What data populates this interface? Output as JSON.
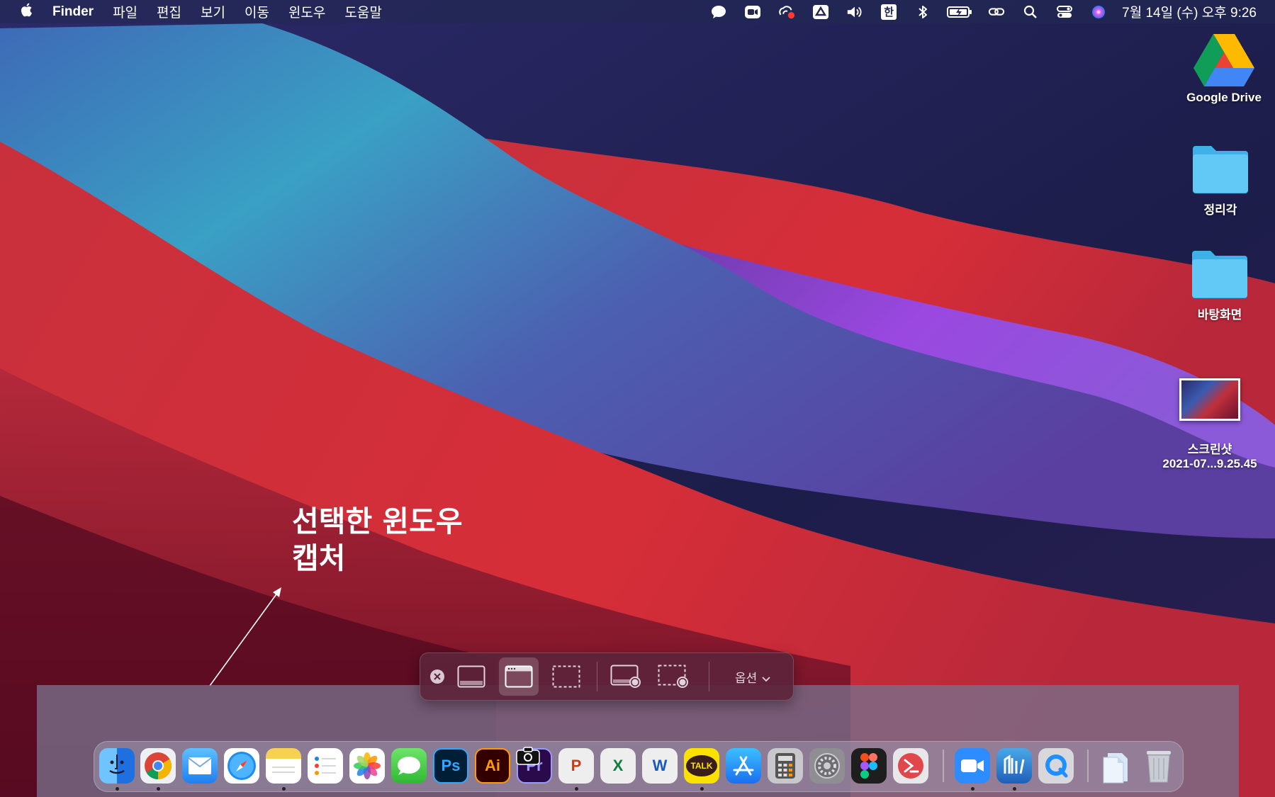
{
  "menubar": {
    "apple_icon": "apple-icon",
    "app_name": "Finder",
    "menus": [
      "파일",
      "편집",
      "보기",
      "이동",
      "윈도우",
      "도움말"
    ],
    "status_icons": [
      "chat-bubble-icon",
      "zoom-video-icon",
      "cloud-sync-icon",
      "google-drive-icon",
      "volume-icon",
      "korean-input-icon",
      "bluetooth-icon",
      "battery-icon",
      "link-icon",
      "search-icon",
      "control-center-icon",
      "siri-icon"
    ],
    "input_label": "한",
    "clock": "7월 14일 (수) 오후 9:26"
  },
  "desktop": {
    "icons": [
      {
        "name": "google-drive",
        "label": "Google Drive"
      },
      {
        "name": "folder-jeongrigak",
        "label": "정리각"
      },
      {
        "name": "folder-desktop",
        "label": "바탕화면"
      },
      {
        "name": "screenshot-file",
        "label": "스크린샷",
        "sublabel": "2021-07...9.25.45"
      }
    ]
  },
  "annotation": {
    "line1": "선택한 윈도우",
    "line2": "캡처"
  },
  "screenshot_toolbar": {
    "buttons": [
      {
        "name": "close",
        "icon": "close-icon",
        "selected": false
      },
      {
        "name": "capture-entire-screen",
        "icon": "screen-icon",
        "selected": false
      },
      {
        "name": "capture-selected-window",
        "icon": "window-icon",
        "selected": true
      },
      {
        "name": "capture-selected-portion",
        "icon": "selection-icon",
        "selected": false
      },
      {
        "name": "record-entire-screen",
        "icon": "screen-record-icon",
        "selected": false
      },
      {
        "name": "record-selected-portion",
        "icon": "portion-record-icon",
        "selected": false
      }
    ],
    "options_label": "옵션"
  },
  "dock": {
    "apps": [
      {
        "name": "finder",
        "running": true
      },
      {
        "name": "chrome",
        "running": true
      },
      {
        "name": "mail",
        "running": false
      },
      {
        "name": "safari",
        "running": false
      },
      {
        "name": "notes",
        "running": true
      },
      {
        "name": "reminders",
        "running": false
      },
      {
        "name": "photos",
        "running": false
      },
      {
        "name": "messages",
        "running": false
      },
      {
        "name": "photoshop",
        "label": "Ps",
        "running": false
      },
      {
        "name": "illustrator",
        "label": "Ai",
        "running": false
      },
      {
        "name": "premiere",
        "label": "Pr",
        "running": false
      },
      {
        "name": "powerpoint",
        "label": "P",
        "running": true
      },
      {
        "name": "excel",
        "label": "X",
        "running": false
      },
      {
        "name": "word",
        "label": "W",
        "running": false
      },
      {
        "name": "kakaotalk",
        "label": "TALK",
        "running": true
      },
      {
        "name": "app-store",
        "running": false
      },
      {
        "name": "calculator",
        "running": false
      },
      {
        "name": "system-preferences",
        "running": false
      },
      {
        "name": "figma",
        "running": false
      },
      {
        "name": "remote-desktop",
        "running": false
      },
      {
        "name": "zoom",
        "running": true
      },
      {
        "name": "hangul",
        "running": true
      },
      {
        "name": "quicktime",
        "running": false
      },
      {
        "name": "documents-folder",
        "running": false
      },
      {
        "name": "trash",
        "running": false
      }
    ]
  },
  "colors": {
    "menubar_bg": "#222850",
    "toolbar_bg": "#5c243a",
    "folder_blue": "#5ac8fa"
  }
}
